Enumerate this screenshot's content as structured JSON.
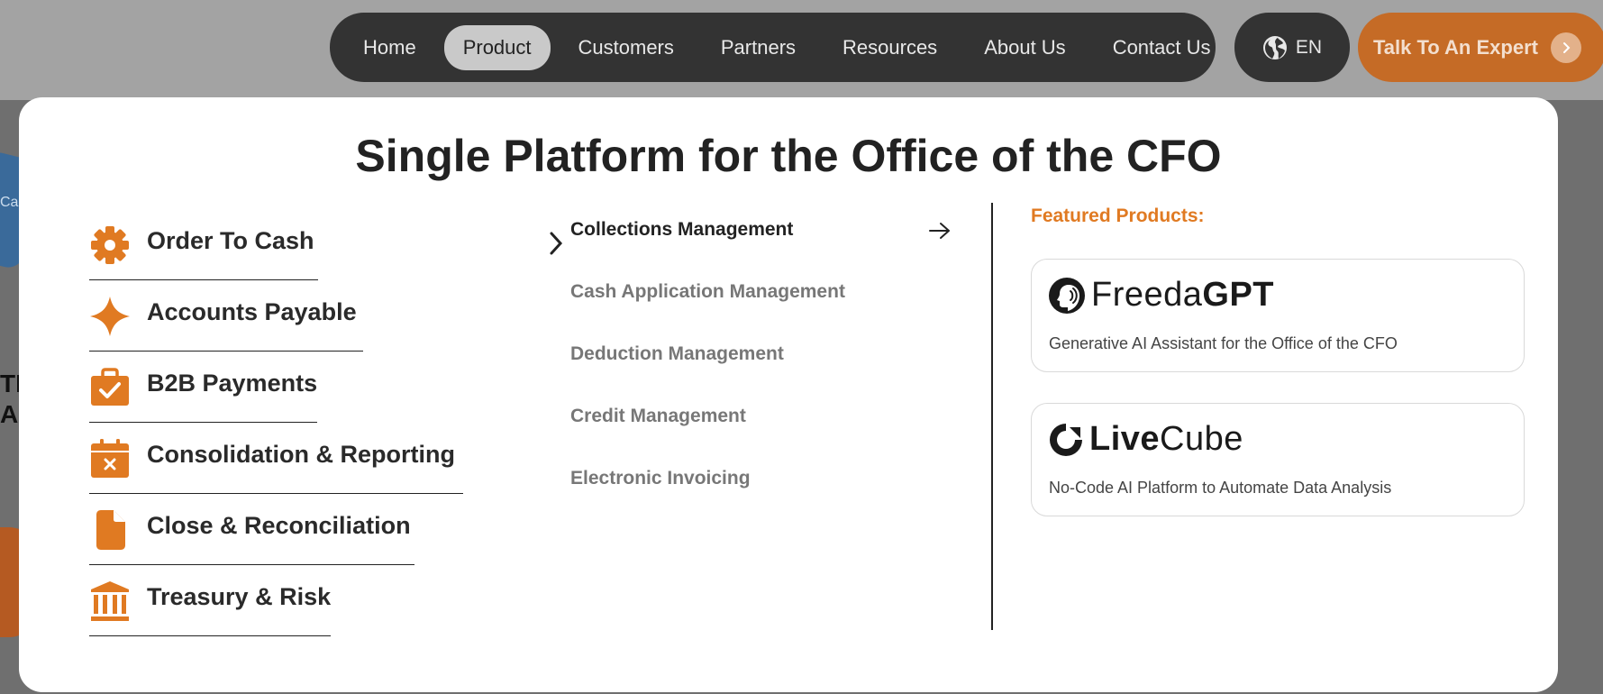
{
  "nav": {
    "items": [
      {
        "label": "Home"
      },
      {
        "label": "Product",
        "active": true
      },
      {
        "label": "Customers"
      },
      {
        "label": "Partners"
      },
      {
        "label": "Resources"
      },
      {
        "label": "About Us"
      },
      {
        "label": "Contact Us"
      }
    ],
    "language": {
      "label": "EN",
      "icon": "globe-icon"
    },
    "cta": {
      "label": "Talk To An Expert",
      "icon": "chevron-right-icon"
    }
  },
  "menu": {
    "title": "Single Platform for the Office of the CFO",
    "categories": [
      {
        "label": "Order To Cash",
        "icon": "gear-icon",
        "active": true
      },
      {
        "label": "Accounts Payable",
        "icon": "sparkle-icon"
      },
      {
        "label": "B2B Payments",
        "icon": "briefcase-check-icon"
      },
      {
        "label": "Consolidation & Reporting",
        "icon": "calendar-x-icon"
      },
      {
        "label": "Close & Reconciliation",
        "icon": "document-icon"
      },
      {
        "label": "Treasury & Risk",
        "icon": "bank-icon"
      }
    ],
    "subitems": [
      {
        "label": "Collections Management",
        "active": true
      },
      {
        "label": "Cash Application Management"
      },
      {
        "label": "Deduction Management"
      },
      {
        "label": "Credit Management"
      },
      {
        "label": "Electronic Invoicing"
      }
    ],
    "featured": {
      "label": "Featured Products:",
      "products": [
        {
          "logo_text_regular": "Freeda",
          "logo_text_bold": "GPT",
          "desc": "Generative AI Assistant for the Office of the CFO"
        },
        {
          "logo_text_bold": "Live",
          "logo_text_regular": "Cube",
          "desc": "No-Code AI Platform to Automate Data Analysis"
        }
      ]
    }
  },
  "background": {
    "fragment_top": "TIC",
    "fragment_bottom": "A",
    "fragment_small": "Ca"
  },
  "colors": {
    "accent": "#e07a22",
    "nav_bg": "#333333",
    "cta_bg": "#c56b26"
  }
}
